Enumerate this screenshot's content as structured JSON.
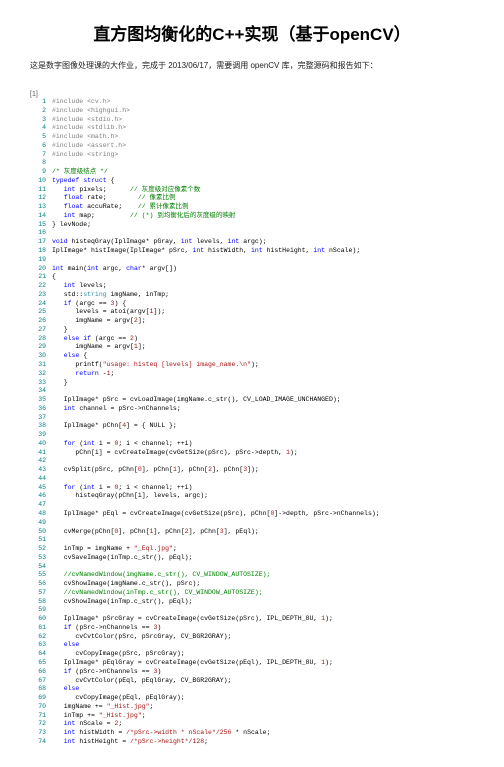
{
  "title": "直方图均衡化的C++实现（基于openCV）",
  "intro": "这是数字图像处理课的大作业，完成于 2013/06/17，需要调用 openCV 库，完整源码和报告如下：",
  "bracket": "[1]",
  "lines": [
    {
      "n": 1,
      "html": "<span class='pp'>#include &lt;cv.h&gt;</span>"
    },
    {
      "n": 2,
      "html": "<span class='pp'>#include &lt;highgui.h&gt;</span>"
    },
    {
      "n": 3,
      "html": "<span class='pp'>#include &lt;stdio.h&gt;</span>"
    },
    {
      "n": 4,
      "html": "<span class='pp'>#include &lt;stdlib.h&gt;</span>"
    },
    {
      "n": 5,
      "html": "<span class='pp'>#include &lt;math.h&gt;</span>"
    },
    {
      "n": 6,
      "html": "<span class='pp'>#include &lt;assert.h&gt;</span>"
    },
    {
      "n": 7,
      "html": "<span class='pp'>#include &lt;string&gt;</span>"
    },
    {
      "n": 8,
      "html": ""
    },
    {
      "n": 9,
      "html": "<span class='cmt'>/* 灰度级结点 */</span>"
    },
    {
      "n": 10,
      "html": "<span class='kw'>typedef</span> <span class='kw'>struct</span> <span class='txt'>{</span>"
    },
    {
      "n": 11,
      "html": "&nbsp;&nbsp;&nbsp;<span class='kw'>int</span> <span class='txt'>pixels;</span>&nbsp;&nbsp;&nbsp;&nbsp;&nbsp;&nbsp;<span class='cmt'>// 灰度级对应像素个数</span>"
    },
    {
      "n": 12,
      "html": "&nbsp;&nbsp;&nbsp;<span class='kw'>float</span> <span class='txt'>rate;</span>&nbsp;&nbsp;&nbsp;&nbsp;&nbsp;&nbsp;&nbsp;&nbsp;<span class='cmt'>// 像素比例</span>"
    },
    {
      "n": 13,
      "html": "&nbsp;&nbsp;&nbsp;<span class='kw'>float</span> <span class='txt'>accuRate;</span>&nbsp;&nbsp;&nbsp;&nbsp;<span class='cmt'>// 累计像素比例</span>"
    },
    {
      "n": 14,
      "html": "&nbsp;&nbsp;&nbsp;<span class='kw'>int</span> <span class='txt'>map;</span>&nbsp;&nbsp;&nbsp;&nbsp;&nbsp;&nbsp;&nbsp;&nbsp;&nbsp;<span class='cmt'>// (*) 到均衡化后的灰度级的映射</span>"
    },
    {
      "n": 15,
      "html": "<span class='txt'>} levNode;</span>"
    },
    {
      "n": 16,
      "html": ""
    },
    {
      "n": 17,
      "html": "<span class='kw'>void</span> <span class='txt'>histeqGray(IplImage* pGray,</span> <span class='kw'>int</span> <span class='txt'>levels,</span> <span class='kw'>int</span> <span class='txt'>argc);</span>"
    },
    {
      "n": 18,
      "html": "<span class='txt'>IplImage* histImage(IplImage* pSrc,</span> <span class='kw'>int</span> <span class='txt'>histWidth,</span> <span class='kw'>int</span> <span class='txt'>histHeight,</span> <span class='kw'>int</span> <span class='txt'>nScale);</span>"
    },
    {
      "n": 19,
      "html": ""
    },
    {
      "n": 20,
      "html": "<span class='kw'>int</span> <span class='txt'>main(</span><span class='kw'>int</span> <span class='txt'>argc,</span> <span class='kw'>char</span><span class='txt'>* argv[])</span>"
    },
    {
      "n": 21,
      "html": "<span class='txt'>{</span>"
    },
    {
      "n": 22,
      "html": "&nbsp;&nbsp;&nbsp;<span class='kw'>int</span> <span class='txt'>levels;</span>"
    },
    {
      "n": 23,
      "html": "&nbsp;&nbsp;&nbsp;<span class='txt'>std::</span><span class='type'>string</span> <span class='txt'>imgName, inTmp;</span>"
    },
    {
      "n": 24,
      "html": "&nbsp;&nbsp;&nbsp;<span class='kw'>if</span> <span class='txt'>(argc ==</span> <span class='num'>3</span><span class='txt'>) {</span>"
    },
    {
      "n": 25,
      "html": "&nbsp;&nbsp;&nbsp;&nbsp;&nbsp;&nbsp;<span class='txt'>levels = atoi(argv[</span><span class='num'>1</span><span class='txt'>]);</span>"
    },
    {
      "n": 26,
      "html": "&nbsp;&nbsp;&nbsp;&nbsp;&nbsp;&nbsp;<span class='txt'>imgName = argv[</span><span class='num'>2</span><span class='txt'>];</span>"
    },
    {
      "n": 27,
      "html": "&nbsp;&nbsp;&nbsp;<span class='txt'>}</span>"
    },
    {
      "n": 28,
      "html": "&nbsp;&nbsp;&nbsp;<span class='kw'>else if</span> <span class='txt'>(argc ==</span> <span class='num'>2</span><span class='txt'>)</span>"
    },
    {
      "n": 29,
      "html": "&nbsp;&nbsp;&nbsp;&nbsp;&nbsp;&nbsp;<span class='txt'>imgName = argv[</span><span class='num'>1</span><span class='txt'>];</span>"
    },
    {
      "n": 30,
      "html": "&nbsp;&nbsp;&nbsp;<span class='kw'>else</span> <span class='txt'>{</span>"
    },
    {
      "n": 31,
      "html": "&nbsp;&nbsp;&nbsp;&nbsp;&nbsp;&nbsp;<span class='txt'>printf(</span><span class='str'>\"usage: histeq [levels] image_name.\\n\"</span><span class='txt'>);</span>"
    },
    {
      "n": 32,
      "html": "&nbsp;&nbsp;&nbsp;&nbsp;&nbsp;&nbsp;<span class='kw'>return</span> <span class='txt'>-</span><span class='num'>1</span><span class='txt'>;</span>"
    },
    {
      "n": 33,
      "html": "&nbsp;&nbsp;&nbsp;<span class='txt'>}</span>"
    },
    {
      "n": 34,
      "html": ""
    },
    {
      "n": 35,
      "html": "&nbsp;&nbsp;&nbsp;<span class='txt'>IplImage* pSrc = cvLoadImage(imgName.c_str(), CV_LOAD_IMAGE_UNCHANGED);</span>"
    },
    {
      "n": 36,
      "html": "&nbsp;&nbsp;&nbsp;<span class='kw'>int</span> <span class='txt'>channel = pSrc-&gt;nChannels;</span>"
    },
    {
      "n": 37,
      "html": ""
    },
    {
      "n": 38,
      "html": "&nbsp;&nbsp;&nbsp;<span class='txt'>IplImage* pChn[</span><span class='num'>4</span><span class='txt'>] = { NULL };</span>"
    },
    {
      "n": 39,
      "html": ""
    },
    {
      "n": 40,
      "html": "&nbsp;&nbsp;&nbsp;<span class='kw'>for</span> <span class='txt'>(</span><span class='kw'>int</span> <span class='txt'>i =</span> <span class='num'>0</span><span class='txt'>; i &lt; channel; ++i)</span>"
    },
    {
      "n": 41,
      "html": "&nbsp;&nbsp;&nbsp;&nbsp;&nbsp;&nbsp;<span class='txt'>pChn[i] = cvCreateImage(cvGetSize(pSrc), pSrc-&gt;depth,</span> <span class='num'>1</span><span class='txt'>);</span>"
    },
    {
      "n": 42,
      "html": ""
    },
    {
      "n": 43,
      "html": "&nbsp;&nbsp;&nbsp;<span class='txt'>cvSplit(pSrc, pChn[</span><span class='num'>0</span><span class='txt'>], pChn[</span><span class='num'>1</span><span class='txt'>], pChn[</span><span class='num'>2</span><span class='txt'>], pChn[</span><span class='num'>3</span><span class='txt'>]);</span>"
    },
    {
      "n": 44,
      "html": ""
    },
    {
      "n": 45,
      "html": "&nbsp;&nbsp;&nbsp;<span class='kw'>for</span> <span class='txt'>(</span><span class='kw'>int</span> <span class='txt'>i =</span> <span class='num'>0</span><span class='txt'>; i &lt; channel; ++i)</span>"
    },
    {
      "n": 46,
      "html": "&nbsp;&nbsp;&nbsp;&nbsp;&nbsp;&nbsp;<span class='txt'>histeqGray(pChn[i], levels, argc);</span>"
    },
    {
      "n": 47,
      "html": ""
    },
    {
      "n": 48,
      "html": "&nbsp;&nbsp;&nbsp;<span class='txt'>IplImage* pEql = cvCreateImage(cvGetSize(pSrc), pChn[</span><span class='num'>0</span><span class='txt'>]-&gt;depth, pSrc-&gt;nChannels);</span>"
    },
    {
      "n": 49,
      "html": ""
    },
    {
      "n": 50,
      "html": "&nbsp;&nbsp;&nbsp;<span class='txt'>cvMerge(pChn[</span><span class='num'>0</span><span class='txt'>], pChn[</span><span class='num'>1</span><span class='txt'>], pChn[</span><span class='num'>2</span><span class='txt'>], pChn[</span><span class='num'>3</span><span class='txt'>], pEql);</span>"
    },
    {
      "n": 51,
      "html": ""
    },
    {
      "n": 52,
      "html": "&nbsp;&nbsp;&nbsp;<span class='txt'>inTmp = imgName +</span> <span class='str'>\"_Eql.jpg\"</span><span class='txt'>;</span>"
    },
    {
      "n": 53,
      "html": "&nbsp;&nbsp;&nbsp;<span class='txt'>cvSaveImage(inTmp.c_str(), pEql);</span>"
    },
    {
      "n": 54,
      "html": ""
    },
    {
      "n": 55,
      "html": "&nbsp;&nbsp;&nbsp;<span class='cmt'>//cvNamedWindow(imgName.c_str(), CV_WINDOW_AUTOSIZE);</span>"
    },
    {
      "n": 56,
      "html": "&nbsp;&nbsp;&nbsp;<span class='txt'>cvShowImage(imgName.c_str(), pSrc);</span>"
    },
    {
      "n": 57,
      "html": "&nbsp;&nbsp;&nbsp;<span class='cmt'>//cvNamedWindow(inTmp.c_str(), CV_WINDOW_AUTOSIZE);</span>"
    },
    {
      "n": 58,
      "html": "&nbsp;&nbsp;&nbsp;<span class='txt'>cvShowImage(inTmp.c_str(), pEql);</span>"
    },
    {
      "n": 59,
      "html": ""
    },
    {
      "n": 60,
      "html": "&nbsp;&nbsp;&nbsp;<span class='txt'>IplImage* pSrcGray = cvCreateImage(cvGetSize(pSrc), IPL_DEPTH_8U,</span> <span class='num'>1</span><span class='txt'>);</span>"
    },
    {
      "n": 61,
      "html": "&nbsp;&nbsp;&nbsp;<span class='kw'>if</span> <span class='txt'>(pSrc-&gt;nChannels ==</span> <span class='num'>3</span><span class='txt'>)</span>"
    },
    {
      "n": 62,
      "html": "&nbsp;&nbsp;&nbsp;&nbsp;&nbsp;&nbsp;<span class='txt'>cvCvtColor(pSrc, pSrcGray, CV_BGR2GRAY);</span>"
    },
    {
      "n": 63,
      "html": "&nbsp;&nbsp;&nbsp;<span class='kw'>else</span>"
    },
    {
      "n": 64,
      "html": "&nbsp;&nbsp;&nbsp;&nbsp;&nbsp;&nbsp;<span class='txt'>cvCopyImage(pSrc, pSrcGray);</span>"
    },
    {
      "n": 65,
      "html": "&nbsp;&nbsp;&nbsp;<span class='txt'>IplImage* pEqlGray = cvCreateImage(cvGetSize(pEql), IPL_DEPTH_8U,</span> <span class='num'>1</span><span class='txt'>);</span>"
    },
    {
      "n": 66,
      "html": "&nbsp;&nbsp;&nbsp;<span class='kw'>if</span> <span class='txt'>(pSrc-&gt;nChannels ==</span> <span class='num'>3</span><span class='txt'>)</span>"
    },
    {
      "n": 67,
      "html": "&nbsp;&nbsp;&nbsp;&nbsp;&nbsp;&nbsp;<span class='txt'>cvCvtColor(pEql, pEqlGray, CV_BGR2GRAY);</span>"
    },
    {
      "n": 68,
      "html": "&nbsp;&nbsp;&nbsp;<span class='kw'>else</span>"
    },
    {
      "n": 69,
      "html": "&nbsp;&nbsp;&nbsp;&nbsp;&nbsp;&nbsp;<span class='txt'>cvCopyImage(pEql, pEqlGray);</span>"
    },
    {
      "n": 70,
      "html": "&nbsp;&nbsp;&nbsp;<span class='txt'>imgName +=</span> <span class='str'>\"_Hist.jpg\"</span><span class='txt'>;</span>"
    },
    {
      "n": 71,
      "html": "&nbsp;&nbsp;&nbsp;<span class='txt'>inTmp +=</span> <span class='str'>\"_Hist.jpg\"</span><span class='txt'>;</span>"
    },
    {
      "n": 72,
      "html": "&nbsp;&nbsp;&nbsp;<span class='kw'>int</span> <span class='txt'>nScale =</span> <span class='num'>2</span><span class='txt'>;</span>"
    },
    {
      "n": 73,
      "html": "&nbsp;&nbsp;&nbsp;<span class='kw'>int</span> <span class='txt'>histWidth =</span> <span class='str'>/*pSrc-&gt;width * nScale*/</span><span class='num'>256</span> <span class='txt'>* nScale;</span>"
    },
    {
      "n": 74,
      "html": "&nbsp;&nbsp;&nbsp;<span class='kw'>int</span> <span class='txt'>histHeight =</span> <span class='str'>/*pSrc-&gt;height*/</span><span class='num'>128</span><span class='txt'>;</span>"
    }
  ]
}
